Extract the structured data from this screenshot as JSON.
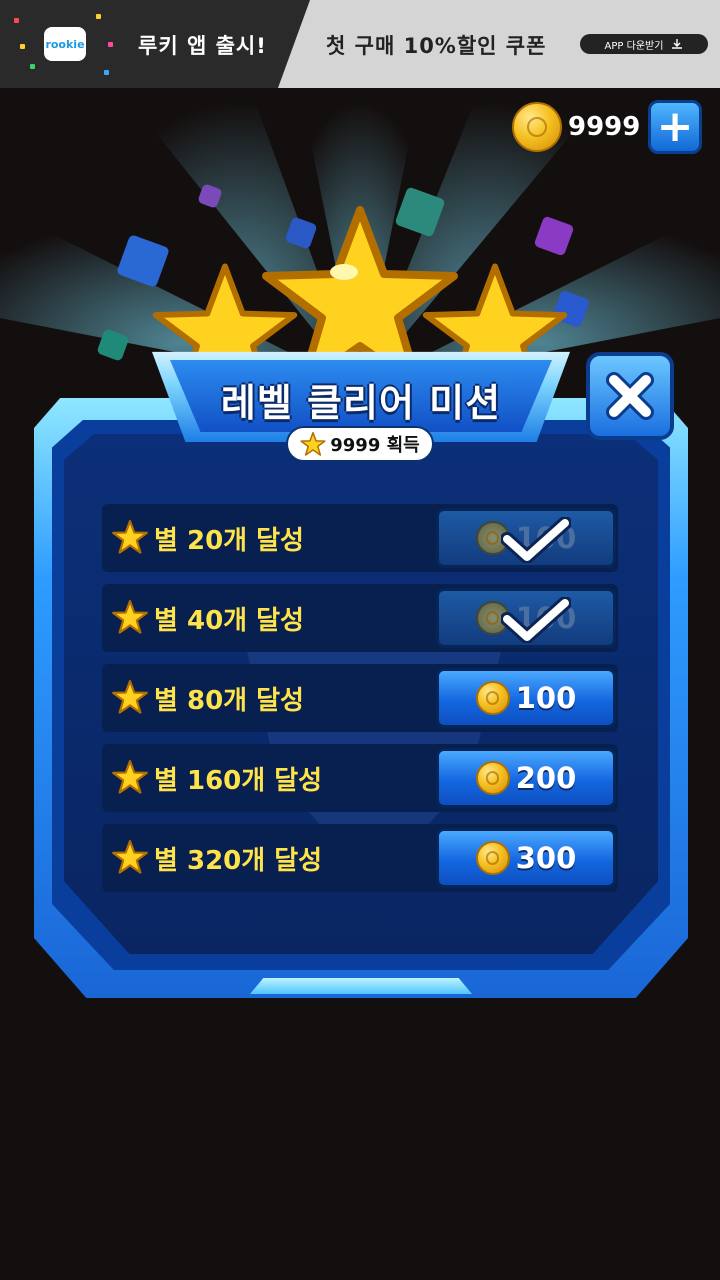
{
  "ad_banner": {
    "logo_text": "rookie",
    "launch_text": "루키 앱 출시!",
    "coupon_text": "첫 구매 10%할인 쿠폰",
    "download_label": "APP 다운받기",
    "download_icon": "download-icon"
  },
  "coins": {
    "count": "9999",
    "add_icon": "plus-icon",
    "coin_icon": "coin-icon"
  },
  "popup": {
    "title": "레벨 클리어 미션",
    "stars_earned": "9999 획득",
    "close_icon": "close-icon"
  },
  "missions": [
    {
      "label": "별 20개 달성",
      "reward": "100",
      "claimed": true
    },
    {
      "label": "별 40개 달성",
      "reward": "100",
      "claimed": true
    },
    {
      "label": "별 80개 달성",
      "reward": "100",
      "claimed": false
    },
    {
      "label": "별 160개 달성",
      "reward": "200",
      "claimed": false
    },
    {
      "label": "별 320개 달성",
      "reward": "300",
      "claimed": false
    }
  ],
  "colors": {
    "background": "#140f0f",
    "accent_blue": "#1467e0",
    "star_yellow": "#ffd21f",
    "label_yellow": "#ffe34a"
  }
}
